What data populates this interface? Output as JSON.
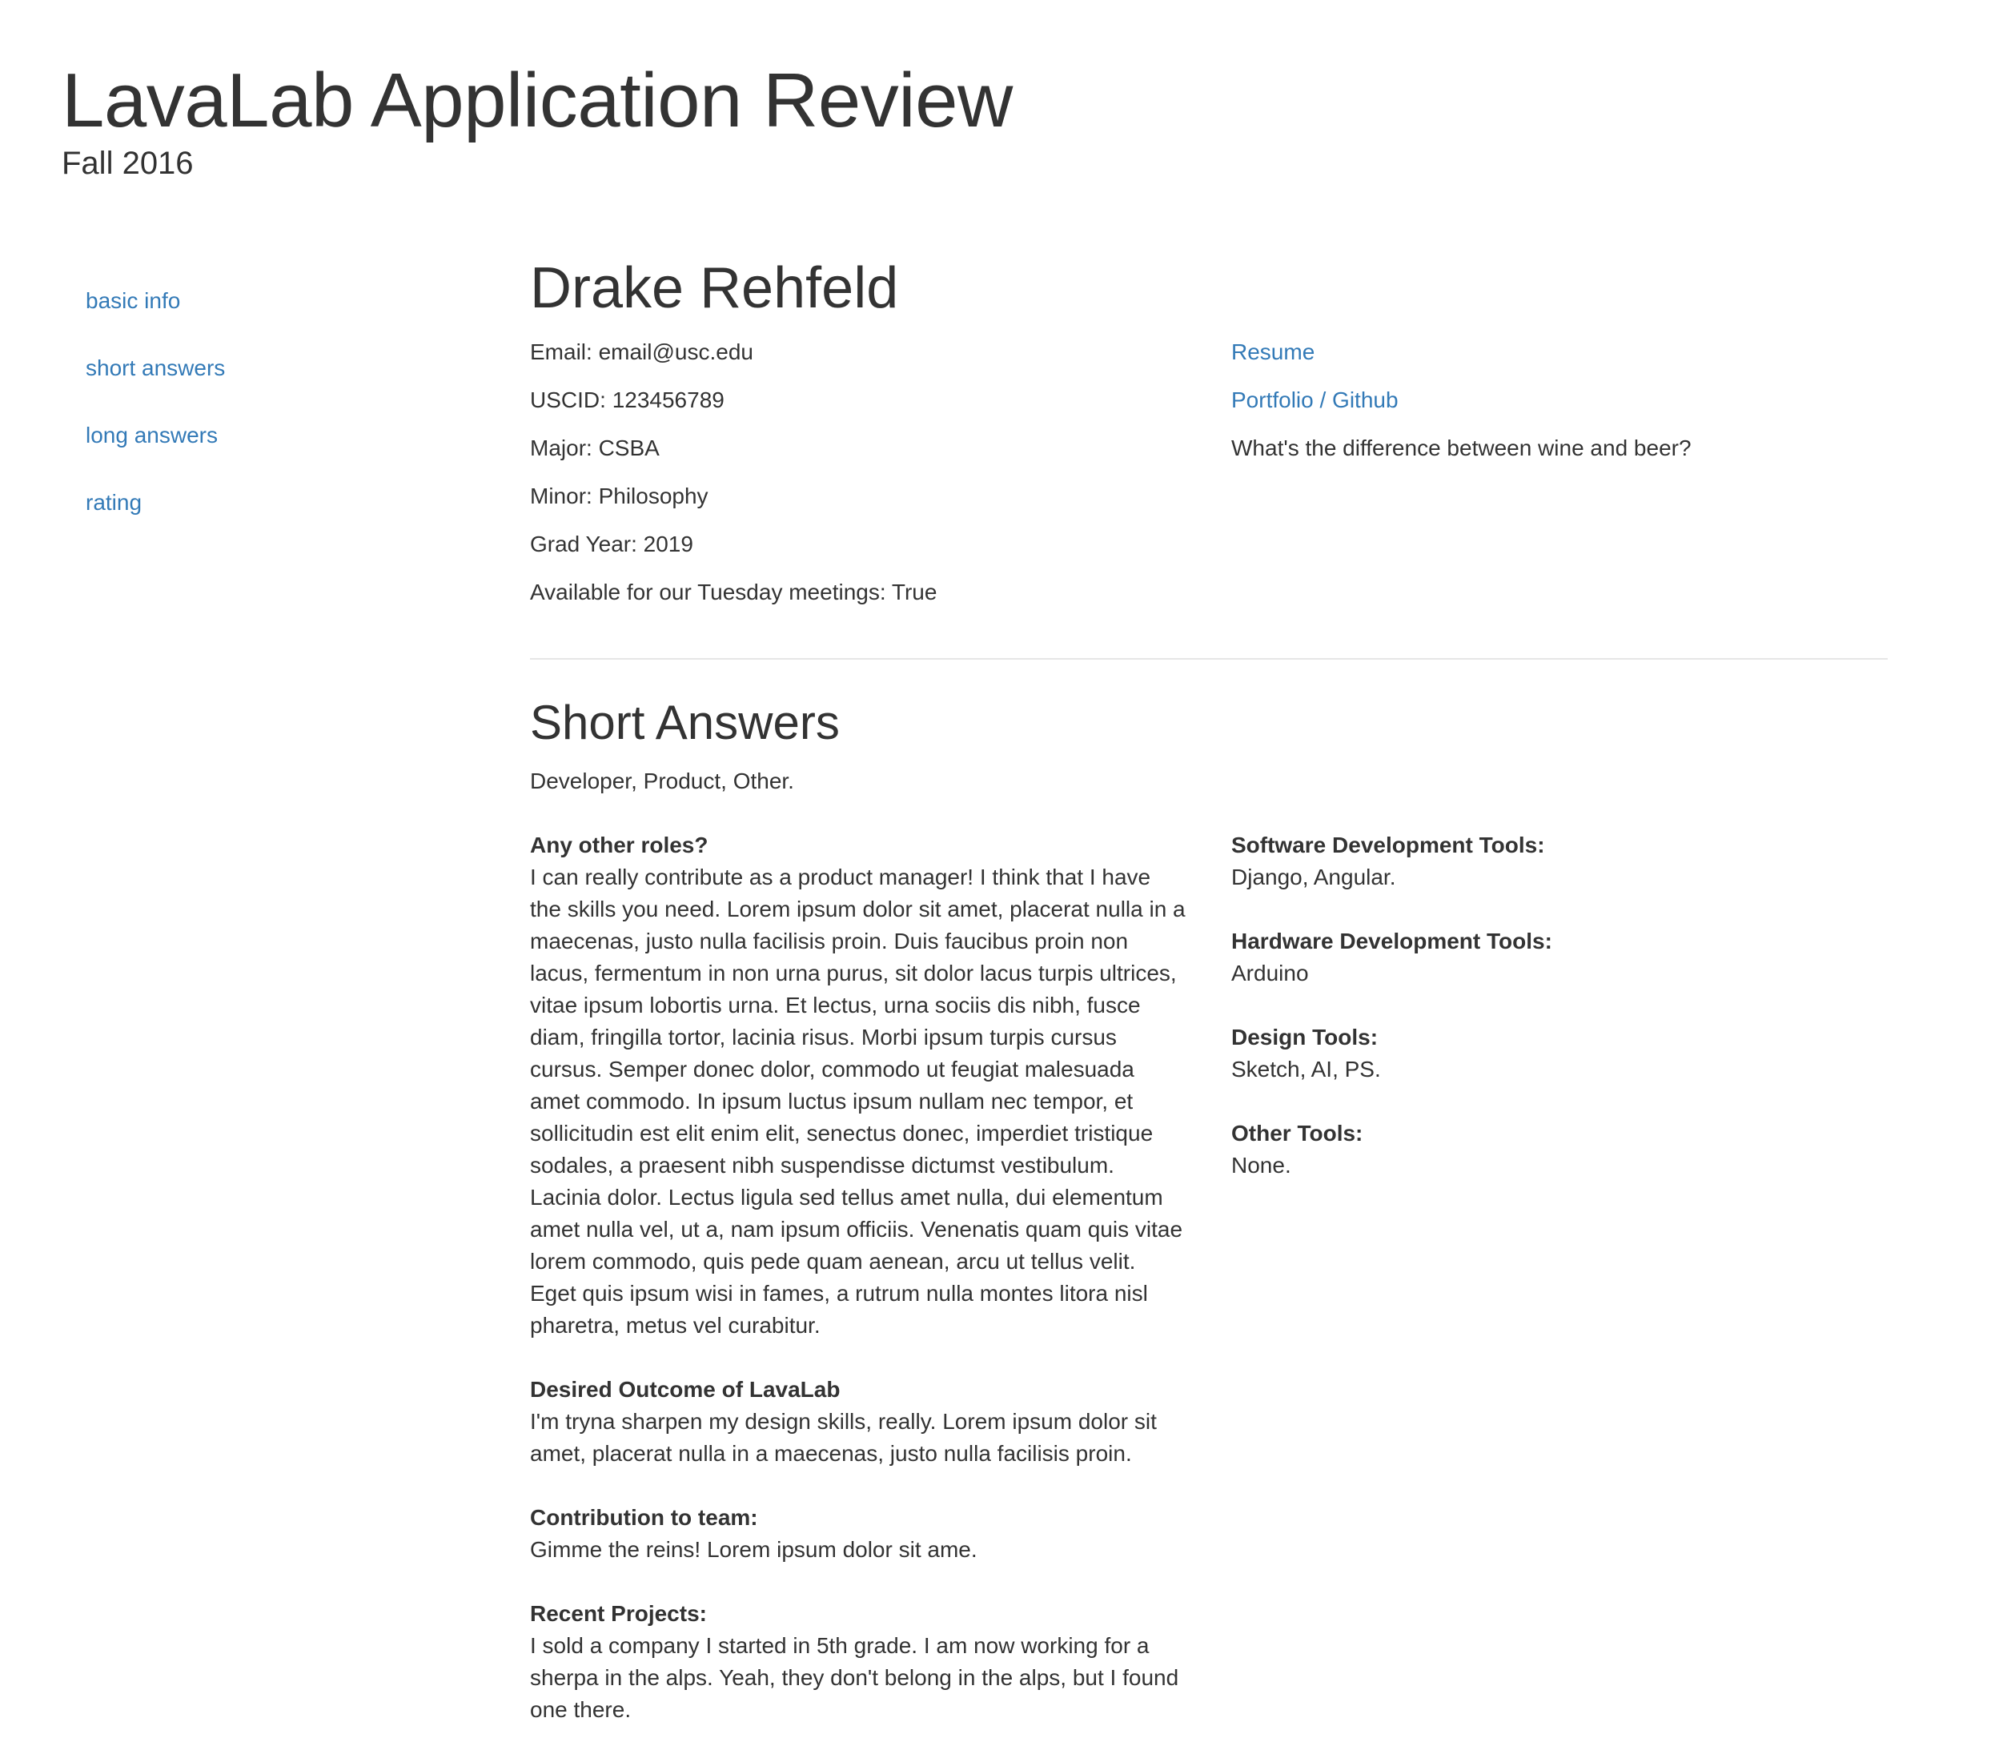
{
  "header": {
    "title": "LavaLab Application Review",
    "subtitle": "Fall 2016"
  },
  "sidebar": {
    "items": [
      {
        "label": "basic info"
      },
      {
        "label": "short answers"
      },
      {
        "label": "long answers"
      },
      {
        "label": "rating"
      }
    ]
  },
  "applicant": {
    "name": "Drake Rehfeld",
    "info": [
      {
        "label": "Email: ",
        "value": "email@usc.edu"
      },
      {
        "label": "USCID: ",
        "value": "123456789"
      },
      {
        "label": "Major: ",
        "value": "CSBA"
      },
      {
        "label": "Minor: ",
        "value": "Philosophy"
      },
      {
        "label": "Grad Year: ",
        "value": "2019"
      },
      {
        "label": "Available for our Tuesday meetings: ",
        "value": "True"
      }
    ],
    "links": {
      "resume": "Resume",
      "portfolio": "Portfolio / Github"
    },
    "question": "What's the difference between wine and beer?"
  },
  "short_answers": {
    "title": "Short Answers",
    "roles": "Developer, Product, Other.",
    "left": [
      {
        "question": "Any other roles?",
        "answer": "I can really contribute as a product manager! I think that I have the skills you need. Lorem ipsum dolor sit amet, placerat nulla in a maecenas, justo nulla facilisis proin. Duis faucibus proin non lacus, fermentum in non urna purus, sit dolor lacus turpis ultrices, vitae ipsum lobortis urna. Et lectus, urna sociis dis nibh, fusce diam, fringilla tortor, lacinia risus. Morbi ipsum turpis cursus cursus. Semper donec dolor, commodo ut feugiat malesuada amet commodo. In ipsum luctus ipsum nullam nec tempor, et sollicitudin est elit enim elit, senectus donec, imperdiet tristique sodales, a praesent nibh suspendisse dictumst vestibulum. Lacinia dolor. Lectus ligula sed tellus amet nulla, dui elementum amet nulla vel, ut a, nam ipsum officiis. Venenatis quam quis vitae lorem commodo, quis pede quam aenean, arcu ut tellus velit. Eget quis ipsum wisi in fames, a rutrum nulla montes litora nisl pharetra, metus vel curabitur."
      },
      {
        "question": "Desired Outcome of LavaLab",
        "answer": "I'm tryna sharpen my design skills, really. Lorem ipsum dolor sit amet, placerat nulla in a maecenas, justo nulla facilisis proin."
      },
      {
        "question": "Contribution to team:",
        "answer": "Gimme the reins! Lorem ipsum dolor sit ame."
      },
      {
        "question": "Recent Projects:",
        "answer": "I sold a company I started in 5th grade. I am now working for a sherpa in the alps. Yeah, they don't belong in the alps, but I found one there."
      }
    ],
    "right": [
      {
        "question": "Software Development Tools:",
        "answer": "Django, Angular."
      },
      {
        "question": "Hardware Development Tools:",
        "answer": "Arduino"
      },
      {
        "question": "Design Tools:",
        "answer": "Sketch, AI, PS."
      },
      {
        "question": "Other Tools:",
        "answer": "None."
      }
    ]
  }
}
